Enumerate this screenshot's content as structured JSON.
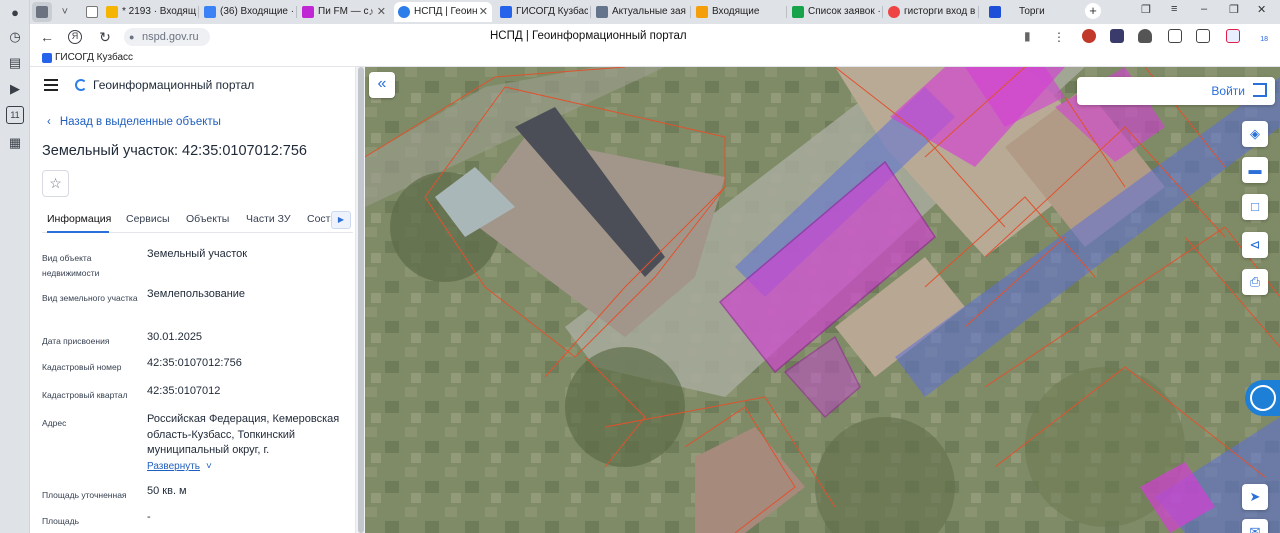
{
  "browser": {
    "tabs": [
      {
        "label": "",
        "fav": "#cfd3d9"
      },
      {
        "label": "* 2193 · Входящ",
        "fav": "#f4b400"
      },
      {
        "label": "(36) Входящие ·",
        "fav": "#3b82f6"
      },
      {
        "label": "Пи FM — с",
        "fav": "#c026d3"
      },
      {
        "label": "НСПД | Геоин",
        "fav": "#2b7de9"
      },
      {
        "label": "ГИСОГД Кузбас",
        "fav": "#2563eb"
      },
      {
        "label": "Актуальные зая",
        "fav": "#64748b"
      },
      {
        "label": "Входящие",
        "fav": "#f59e0b"
      },
      {
        "label": "Список заявок ·",
        "fav": "#16a34a"
      },
      {
        "label": "гисторги вход в",
        "fav": "#ef4444"
      },
      {
        "label": "Торги",
        "fav": "#1d4ed8"
      }
    ],
    "new_tab": "+",
    "url": "nspd.gov.ru",
    "page_title": "НСПД | Геоинформационный портал",
    "bookmark": "ГИСОГД Кузбасс",
    "rail_badge": "11",
    "extension_badge": "18"
  },
  "panel": {
    "portal_name": "Геоинформационный портал",
    "back_link": "Назад в выделенные объекты",
    "object_title": "Земельный участок: 42:35:0107012:756",
    "tabs": [
      "Информация",
      "Сервисы",
      "Объекты",
      "Части ЗУ",
      "Соста"
    ],
    "fields": [
      {
        "label": "Вид объекта недвижимости",
        "value": "Земельный участок"
      },
      {
        "label": "Вид земельного участка",
        "value": "Землепользование"
      },
      {
        "label": "Дата присвоения",
        "value": "30.01.2025"
      },
      {
        "label": "Кадастровый номер",
        "value": "42:35:0107012:756"
      },
      {
        "label": "Кадастровый квартал",
        "value": "42:35:0107012"
      },
      {
        "label": "Адрес",
        "value": "Российская Федерация, Кемеровская область-Кузбасс, Топкинский муниципальный округ, г."
      },
      {
        "label": "Площадь уточненная",
        "value": "50 кв. м"
      },
      {
        "label": "Площадь декларированная",
        "value": "-"
      }
    ],
    "expand_label": "Развернуть"
  },
  "map": {
    "login_label": "Войти",
    "tools": [
      "layers-icon",
      "ruler-icon",
      "select-area-icon",
      "share-icon",
      "print-icon",
      "navigate-icon",
      "message-icon"
    ]
  },
  "colors": {
    "accent": "#2b6fd9",
    "parcel_outline": "#e0522e",
    "highlight_magenta": "#d43fd6",
    "highlight_blue": "#5b6fd8"
  }
}
